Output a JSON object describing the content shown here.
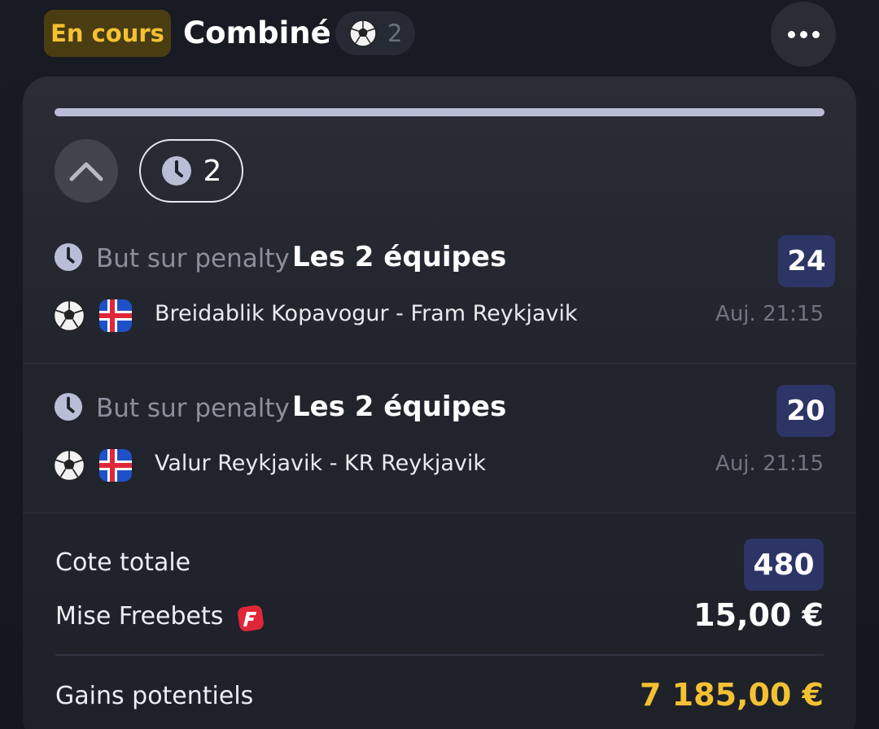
{
  "header": {
    "status": "En cours",
    "title": "Combiné",
    "selections_count": "2",
    "more_label": "•••"
  },
  "card": {
    "progress": 1.0,
    "pending_count": "2",
    "selections": [
      {
        "market": "But sur penalty",
        "pick": "Les 2 équipes",
        "odds": "24",
        "match": "Breidablik Kopavogur - Fram Reykjavik",
        "time": "Auj. 21:15",
        "sport_icon": "soccer-ball-icon",
        "flag_icon": "iceland-flag-icon"
      },
      {
        "market": "But sur penalty",
        "pick": "Les 2 équipes",
        "odds": "20",
        "match": "Valur Reykjavik - KR Reykjavik",
        "time": "Auj. 21:15",
        "sport_icon": "soccer-ball-icon",
        "flag_icon": "iceland-flag-icon"
      }
    ],
    "summary": {
      "total_odds_label": "Cote totale",
      "total_odds": "480",
      "stake_label": "Mise Freebets",
      "stake": "15,00 €",
      "gains_label": "Gains potentiels",
      "gains": "7 185,00 €"
    }
  },
  "colors": {
    "background": "#14171e",
    "card": "#22252d",
    "accent_yellow": "#f4c133",
    "odds_badge": "#2d3566",
    "freebet_red": "#e0273a"
  }
}
